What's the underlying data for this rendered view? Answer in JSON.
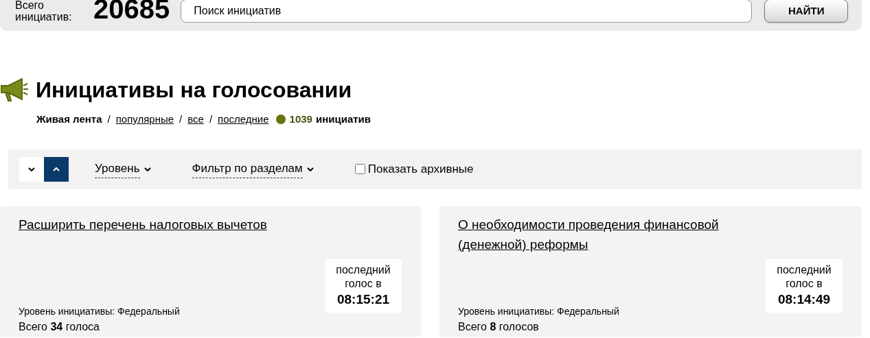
{
  "header": {
    "total_label": "Всего инициатив:",
    "total_count": "20685",
    "search": {
      "value": "Поиск инициатив"
    },
    "search_button": "НАЙТИ"
  },
  "section": {
    "title": "Инициативы на голосовании",
    "nav": [
      {
        "label": "Живая лента",
        "selected": true
      },
      {
        "label": "популярные",
        "selected": false
      },
      {
        "label": "все",
        "selected": false
      },
      {
        "label": "последние",
        "selected": false
      }
    ],
    "separator": "/",
    "count": "1039",
    "count_label": "инициатив"
  },
  "filters": {
    "sort": [
      {
        "kind": "down",
        "selected": false
      },
      {
        "kind": "up",
        "selected": true
      }
    ],
    "dropdowns": [
      "Уровень",
      "Фильтр по разделам"
    ],
    "archive": {
      "label": "Показать архивные",
      "checked": false
    }
  },
  "cards": [
    {
      "title": "Расширить перечень налоговых вычетов",
      "last_vote_label": "последний голос в",
      "last_vote_time": "08:15:21",
      "level": "Уровень инициативы: Федеральный",
      "votes": "Всего **34** голоса"
    },
    {
      "title": "О необходимости проведения финансовой (денежной) реформы",
      "last_vote_label": "последний голос в",
      "last_vote_time": "08:14:49",
      "level": "Уровень инициативы: Федеральный",
      "votes": "Всего **8** голосов"
    }
  ]
}
